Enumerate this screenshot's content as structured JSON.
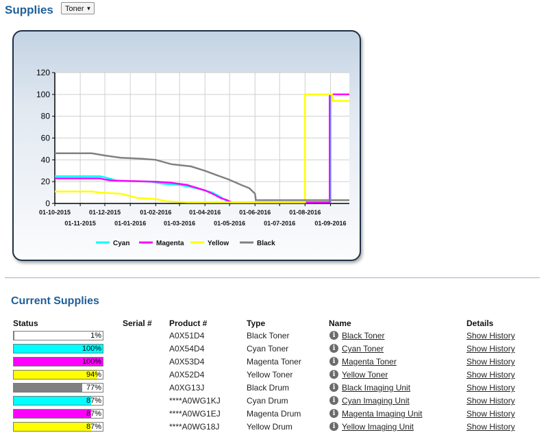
{
  "header": {
    "title": "Supplies",
    "select_value": "Toner"
  },
  "chart_data": {
    "type": "line",
    "ylim": [
      0,
      120
    ],
    "yticks": [
      0,
      20,
      40,
      60,
      80,
      100,
      120
    ],
    "grid": true,
    "legend_position": "bottom",
    "xticks_top": [
      "01-10-2015",
      "01-12-2015",
      "01-02-2016",
      "01-04-2016",
      "01-06-2016",
      "01-08-2016"
    ],
    "xticks_bottom": [
      "01-11-2015",
      "01-01-2016",
      "01-03-2016",
      "01-05-2016",
      "01-07-2016",
      "01-09-2016"
    ],
    "series": [
      {
        "name": "Cyan",
        "color": "#00ffff",
        "points": [
          [
            "2015-10-01",
            25
          ],
          [
            "2015-11-25",
            25
          ],
          [
            "2015-12-01",
            24
          ],
          [
            "2015-12-15",
            21
          ],
          [
            "2016-01-25",
            20
          ],
          [
            "2016-02-10",
            18
          ],
          [
            "2016-03-01",
            17
          ],
          [
            "2016-03-15",
            15
          ],
          [
            "2016-04-01",
            12
          ],
          [
            "2016-04-10",
            10
          ],
          [
            "2016-04-20",
            6
          ],
          [
            "2016-04-28",
            2
          ],
          [
            "2016-05-05",
            1
          ],
          [
            "2016-06-01",
            1
          ],
          [
            "2016-06-05",
            1
          ],
          [
            "2016-09-01",
            1
          ],
          [
            "2016-09-01",
            100
          ],
          [
            "2016-09-24",
            100
          ]
        ]
      },
      {
        "name": "Magenta",
        "color": "#ff00ff",
        "points": [
          [
            "2015-10-01",
            23
          ],
          [
            "2015-11-25",
            23
          ],
          [
            "2015-12-01",
            22
          ],
          [
            "2015-12-10",
            21
          ],
          [
            "2016-02-01",
            20
          ],
          [
            "2016-02-20",
            19
          ],
          [
            "2016-03-10",
            17
          ],
          [
            "2016-04-01",
            12
          ],
          [
            "2016-04-10",
            9
          ],
          [
            "2016-04-20",
            5
          ],
          [
            "2016-04-28",
            3
          ],
          [
            "2016-05-03",
            1
          ],
          [
            "2016-06-01",
            1
          ],
          [
            "2016-08-31",
            1
          ],
          [
            "2016-08-31",
            100
          ],
          [
            "2016-09-24",
            100
          ]
        ]
      },
      {
        "name": "Yellow",
        "color": "#ffff00",
        "points": [
          [
            "2015-10-01",
            11
          ],
          [
            "2015-11-15",
            11
          ],
          [
            "2015-11-25",
            10
          ],
          [
            "2015-12-20",
            9
          ],
          [
            "2016-01-10",
            5
          ],
          [
            "2016-02-01",
            4
          ],
          [
            "2016-02-15",
            2
          ],
          [
            "2016-03-10",
            1
          ],
          [
            "2016-08-01",
            1
          ],
          [
            "2016-08-01",
            100
          ],
          [
            "2016-09-03",
            100
          ],
          [
            "2016-09-03",
            94
          ],
          [
            "2016-09-24",
            94
          ]
        ]
      },
      {
        "name": "Black",
        "color": "#808080",
        "points": [
          [
            "2015-10-01",
            46
          ],
          [
            "2015-11-15",
            46
          ],
          [
            "2015-12-01",
            44
          ],
          [
            "2015-12-20",
            42
          ],
          [
            "2016-01-15",
            41
          ],
          [
            "2016-02-01",
            40
          ],
          [
            "2016-02-20",
            36
          ],
          [
            "2016-03-15",
            34
          ],
          [
            "2016-04-01",
            30
          ],
          [
            "2016-04-15",
            26
          ],
          [
            "2016-04-30",
            22
          ],
          [
            "2016-05-15",
            17
          ],
          [
            "2016-05-25",
            14
          ],
          [
            "2016-06-01",
            9
          ],
          [
            "2016-06-02",
            3
          ],
          [
            "2016-09-24",
            3
          ]
        ]
      }
    ]
  },
  "current_supplies": {
    "title": "Current Supplies",
    "headers": {
      "status": "Status",
      "serial": "Serial #",
      "product": "Product #",
      "type": "Type",
      "name": "Name",
      "details": "Details"
    },
    "rows": [
      {
        "percent": 1,
        "percent_label": "1%",
        "color": "#808080",
        "serial": "",
        "product": "A0X51D4",
        "type": "Black Toner",
        "name": "Black Toner",
        "details": "Show History"
      },
      {
        "percent": 100,
        "percent_label": "100%",
        "color": "#00ffff",
        "serial": "",
        "product": "A0X54D4",
        "type": "Cyan Toner",
        "name": "Cyan Toner",
        "details": "Show History"
      },
      {
        "percent": 100,
        "percent_label": "100%",
        "color": "#ff00ff",
        "serial": "",
        "product": "A0X53D4",
        "type": "Magenta Toner",
        "name": "Magenta Toner",
        "details": "Show History"
      },
      {
        "percent": 94,
        "percent_label": "94%",
        "color": "#ffff00",
        "serial": "",
        "product": "A0X52D4",
        "type": "Yellow Toner",
        "name": "Yellow Toner",
        "details": "Show History"
      },
      {
        "percent": 77,
        "percent_label": "77%",
        "color": "#808080",
        "serial": "",
        "product": "A0XG13J",
        "type": "Black Drum",
        "name": "Black Imaging Unit",
        "details": "Show History"
      },
      {
        "percent": 87,
        "percent_label": "87%",
        "color": "#00ffff",
        "serial": "",
        "product": "****A0WG1KJ",
        "type": "Cyan Drum",
        "name": "Cyan Imaging Unit",
        "details": "Show History"
      },
      {
        "percent": 87,
        "percent_label": "87%",
        "color": "#ff00ff",
        "serial": "",
        "product": "****A0WG1EJ",
        "type": "Magenta Drum",
        "name": "Magenta Imaging Unit",
        "details": "Show History"
      },
      {
        "percent": 87,
        "percent_label": "87%",
        "color": "#ffff00",
        "serial": "",
        "product": "****A0WG18J",
        "type": "Yellow Drum",
        "name": "Yellow Imaging Unit",
        "details": "Show History"
      }
    ]
  }
}
